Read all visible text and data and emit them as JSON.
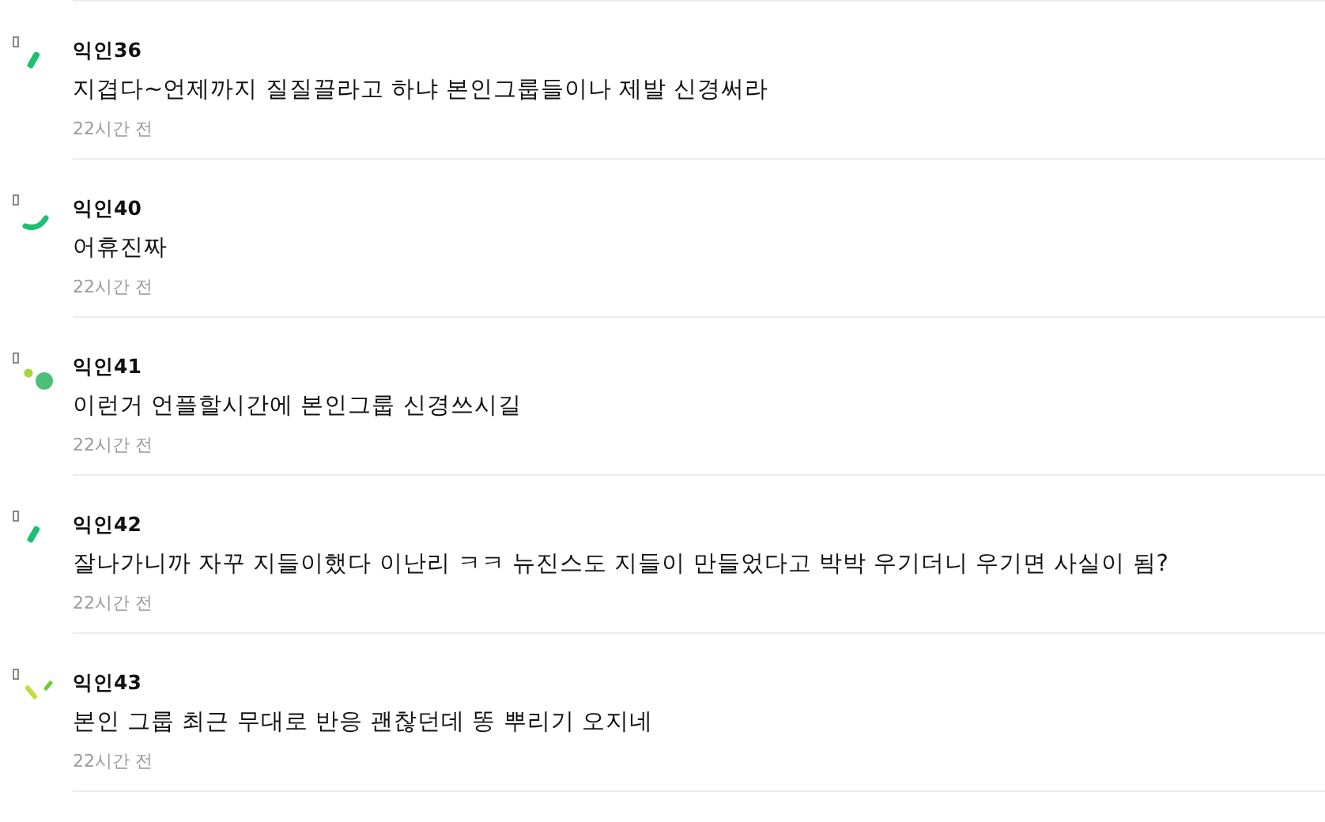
{
  "comments": [
    {
      "author": "익인36",
      "text": "지겹다~언제까지 질질끌라고 하냐 본인그룹들이나 제발 신경써라",
      "time": "22시간 전"
    },
    {
      "author": "익인40",
      "text": "어휴진짜",
      "time": "22시간 전"
    },
    {
      "author": "익인41",
      "text": "이런거 언플할시간에 본인그룹 신경쓰시길",
      "time": "22시간 전"
    },
    {
      "author": "익인42",
      "text": "잘나가니까 자꾸 지들이했다 이난리 ㅋㅋ 뉴진스도 지들이 만들었다고 박박 우기더니 우기면 사실이 됨?",
      "time": "22시간 전"
    },
    {
      "author": "익인43",
      "text": "본인 그룹 최근 무대로 반응 괜찮던데 똥 뿌리기 오지네",
      "time": "22시간 전"
    }
  ]
}
